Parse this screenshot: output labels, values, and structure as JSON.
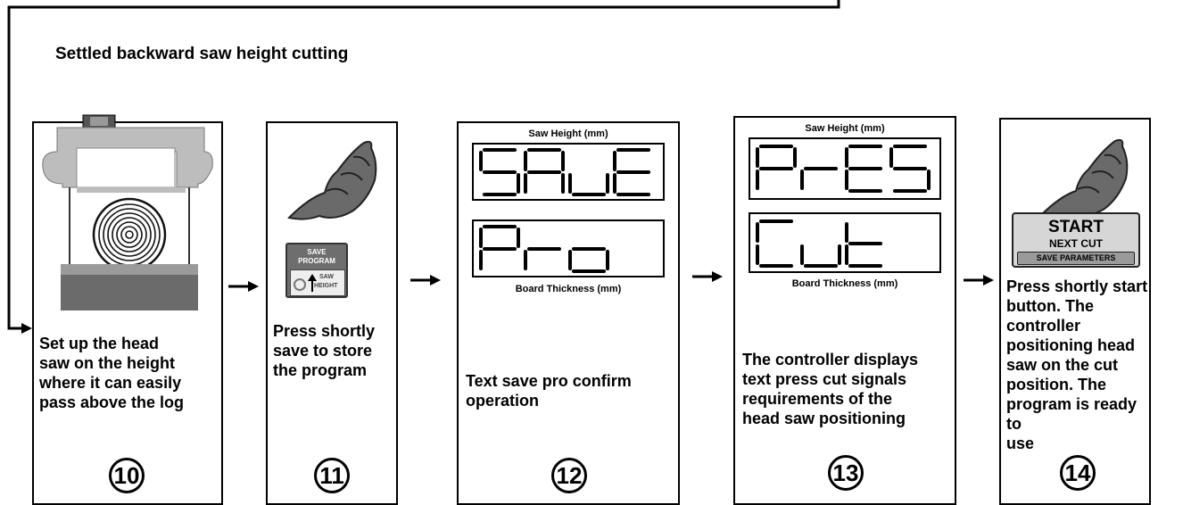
{
  "title": "Settled backward saw height cutting",
  "steps": [
    {
      "number": "10",
      "text": "Set up the head\nsaw on the height\nwhere it can easily\npass above the log"
    },
    {
      "number": "11",
      "text": "Press shortly\nsave to store\nthe program"
    },
    {
      "number": "12",
      "text": "Text save pro confirm\noperation"
    },
    {
      "number": "13",
      "text": "The controller displays\ntext press cut signals\nrequirements of the\nhead saw positioning"
    },
    {
      "number": "14",
      "text": "Press shortly start\nbutton. The\ncontroller\npositioning head\nsaw on the cut\nposition. The\nprogram is ready to\nuse"
    }
  ],
  "display12": {
    "top_caption": "Saw Height (mm)",
    "top_text": "SAuE",
    "bottom_text": "Pro",
    "bottom_caption": "Board Thickness (mm)"
  },
  "display13": {
    "top_caption": "Saw Height (mm)",
    "top_text": "PrES",
    "bottom_text": "Cut",
    "bottom_caption": "Board Thickness (mm)"
  },
  "save_button": {
    "line1": "SAVE",
    "line2": "PROGRAM",
    "line3": "SAW",
    "line4": "HEIGHT"
  },
  "start_button": {
    "line1": "START",
    "line2": "NEXT CUT",
    "line3": "SAVE PARAMETERS"
  },
  "icons": [
    "hand-press-icon",
    "saw-head-icon",
    "log-icon",
    "arrow-right-icon"
  ]
}
